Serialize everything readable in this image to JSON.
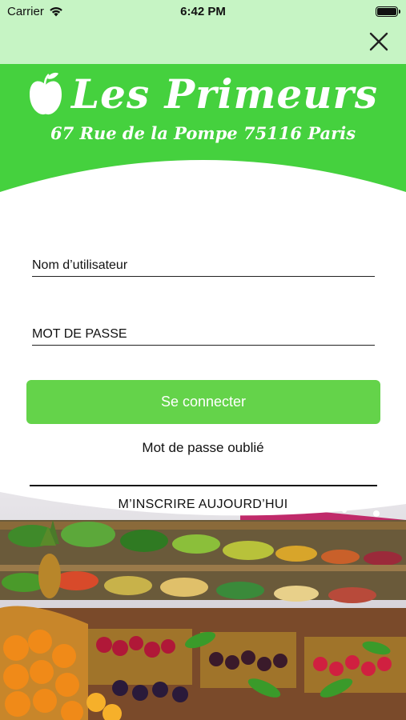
{
  "status_bar": {
    "carrier": "Carrier",
    "time": "6:42 PM"
  },
  "nav": {
    "close_icon": "close-icon"
  },
  "brand": {
    "name": "Les Primeurs",
    "address": "67 Rue de la Pompe 75116 Paris",
    "logo_icon": "apple-icon"
  },
  "login": {
    "username_placeholder": "Nom d’utilisateur",
    "password_placeholder": "MOT DE PASSE",
    "submit_label": "Se connecter",
    "forgot_label": "Mot de passe oublié",
    "signup_label": "M’INSCRIRE AUJOURD’HUI"
  },
  "colors": {
    "topbar": "#c6f4c4",
    "header_green": "#45d13e",
    "button_green": "#64d34a"
  }
}
